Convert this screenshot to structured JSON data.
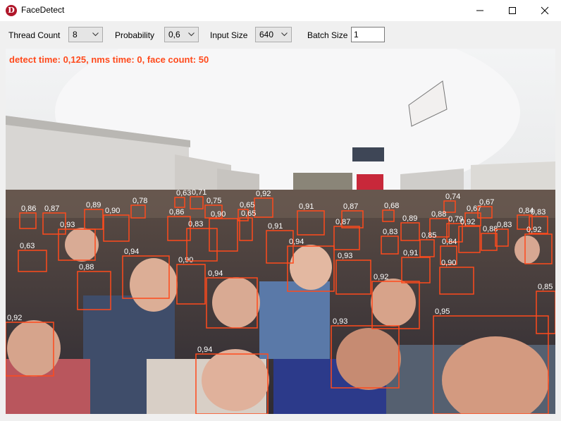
{
  "window": {
    "title": "FaceDetect",
    "app_icon_letter": "D",
    "accent_color": "#b0172a"
  },
  "toolbar": {
    "thread_count_label": "Thread Count",
    "thread_count_value": "8",
    "probability_label": "Probability",
    "probability_value": "0,6",
    "input_size_label": "Input Size",
    "input_size_value": "640",
    "batch_size_label": "Batch Size",
    "batch_size_value": "1"
  },
  "status": {
    "text": "detect time: 0,125, nms time: 0, face count: 50",
    "color": "#ff4a1c"
  },
  "detection_box_color": "#ff4a1c",
  "detections": [
    "0,86",
    "0,87",
    "0,89",
    "0,78",
    "0,63",
    "0,71",
    "0,75",
    "0,92",
    "0,65",
    "0,87",
    "0,68",
    "0,74",
    "0,67",
    "0,67",
    "0,84",
    "0,83",
    "0,93",
    "0,90",
    "0,86",
    "0,90",
    "0,65",
    "0,91",
    "0,91",
    "0,87",
    "0,89",
    "0,88",
    "0,79",
    "0,92",
    "0,88",
    "0,83",
    "0,83",
    "0,85",
    "0,84",
    "0,92",
    "0,63",
    "0,94",
    "0,94",
    "0,90",
    "0,83",
    "0,88",
    "0,93",
    "0,91",
    "0,90",
    "0,94",
    "0,92",
    "0,85",
    "0,92",
    "0,95",
    "0,93",
    "0,94"
  ]
}
